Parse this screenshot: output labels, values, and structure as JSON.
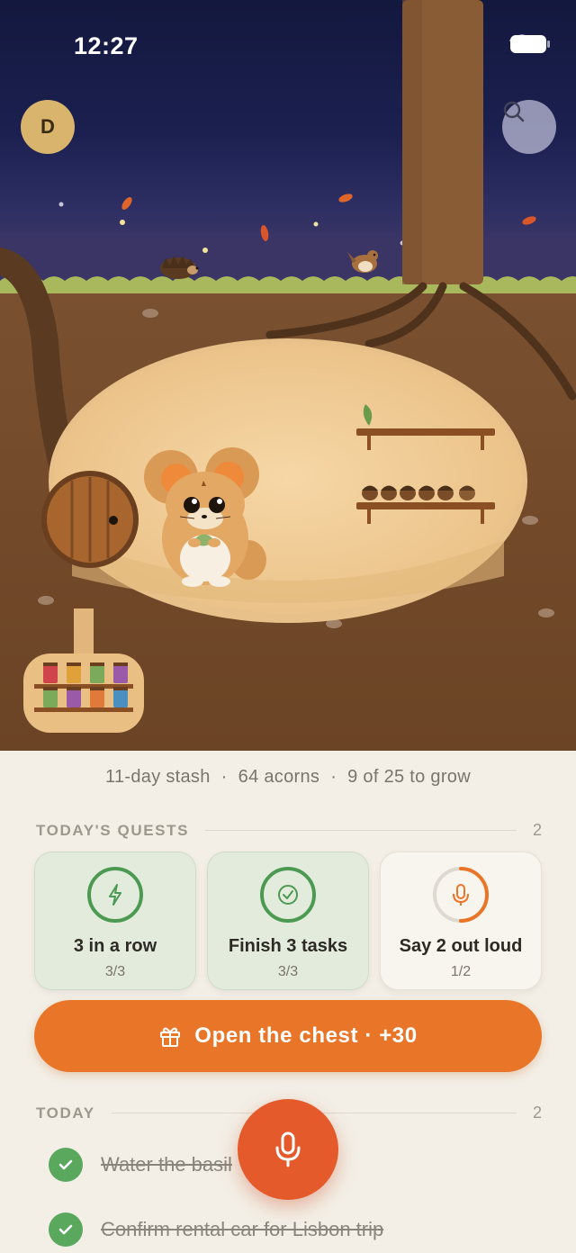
{
  "status_bar": {
    "time": "12:27"
  },
  "header": {
    "avatar_initial": "D"
  },
  "icons": {
    "avatar": "avatar",
    "search": "search-icon",
    "gift": "gift-icon",
    "mic": "microphone-icon",
    "check": "check-icon",
    "lightning": "lightning-icon",
    "check_circle": "check-circle-icon"
  },
  "stats": {
    "streak": "11-day stash",
    "acorns": "64 acorns",
    "growth": "9 of 25 to grow",
    "separator": "·"
  },
  "quests_section": {
    "label": "TODAY'S QUESTS",
    "count": "2",
    "items": [
      {
        "title": "3 in a row",
        "progress": "3/3",
        "icon": "lightning-icon",
        "fraction": 1.0,
        "complete": true
      },
      {
        "title": "Finish 3 tasks",
        "progress": "3/3",
        "icon": "check-circle-icon",
        "fraction": 1.0,
        "complete": true
      },
      {
        "title": "Say 2 out loud",
        "progress": "1/2",
        "icon": "microphone-icon",
        "fraction": 0.5,
        "complete": false
      }
    ]
  },
  "chest_button": {
    "label": "Open the chest · +30"
  },
  "today_section": {
    "label": "TODAY",
    "count": "2",
    "tasks": [
      {
        "text": "Water the basil",
        "done": true
      },
      {
        "text": "Confirm rental car for Lisbon trip",
        "done": true
      }
    ]
  },
  "colors": {
    "accent": "#e97628",
    "mic": "#e55a2b",
    "done_green": "#5aa85e",
    "quest_green": "#4c9a52",
    "sky": "#1c2050",
    "soil": "#7a5130"
  }
}
